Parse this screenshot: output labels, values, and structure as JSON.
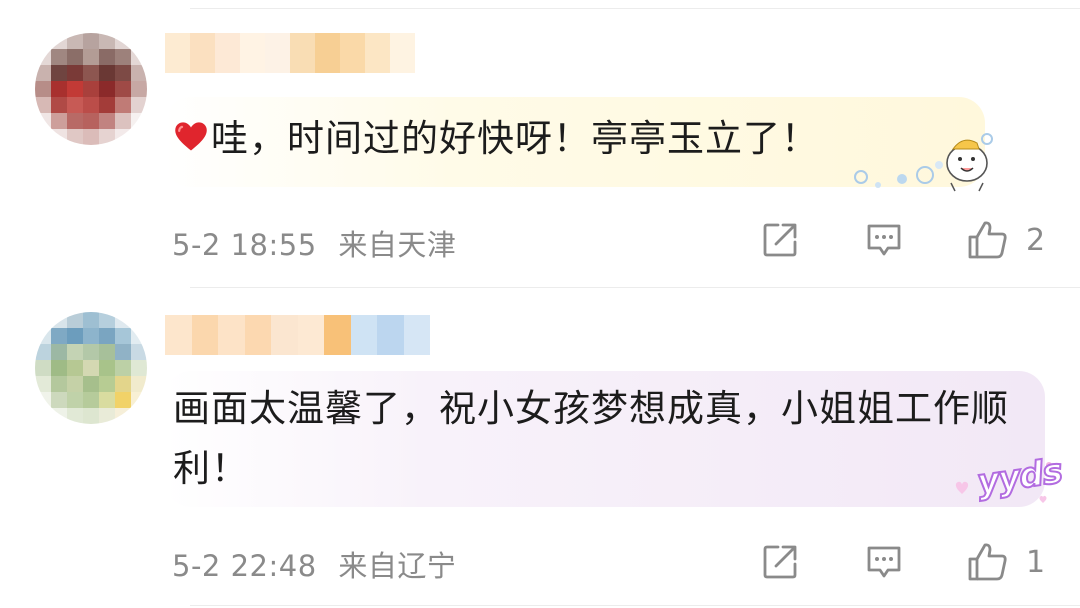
{
  "comments": [
    {
      "text": "哇，时间过的好快呀！亭亭玉立了！",
      "date": "5-2 18:55",
      "location": "来自天津",
      "like_count": "2"
    },
    {
      "text": "画面太温馨了，祝小女孩梦想成真，小姐姐工作顺利！",
      "date": "5-2 22:48",
      "location": "来自辽宁",
      "like_count": "1"
    }
  ],
  "stickers": {
    "yyds": "yyds"
  },
  "icons": {
    "share": "share-icon",
    "reply": "comment-icon",
    "like": "thumbs-up-icon",
    "heart": "heart-icon"
  },
  "colors": {
    "text": "#1c1c1c",
    "meta": "#8a8a8a",
    "heart": "#e0252d"
  }
}
